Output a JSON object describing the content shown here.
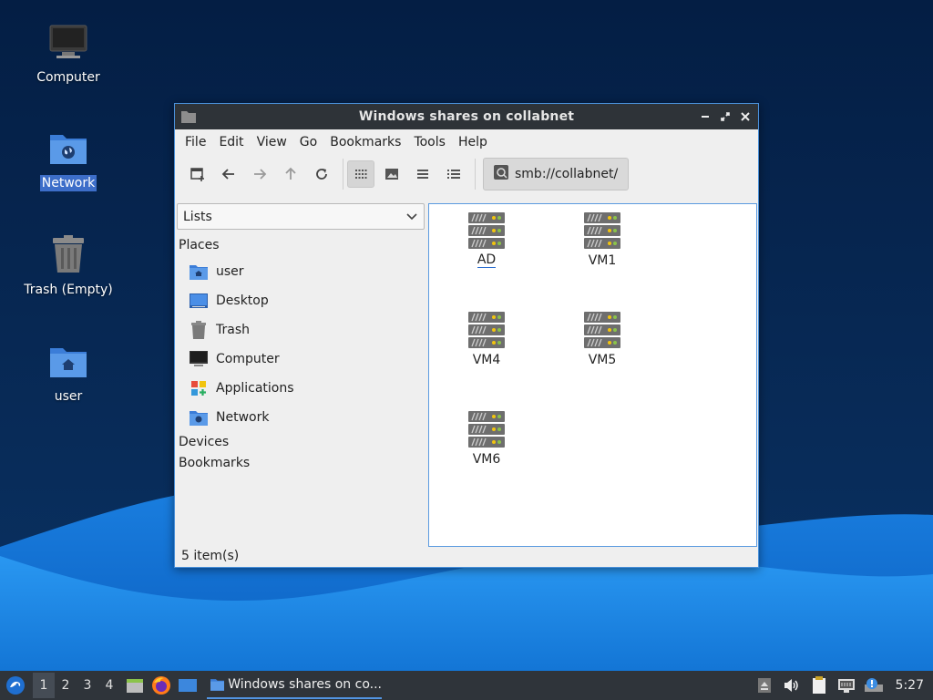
{
  "desktop": {
    "icons": [
      {
        "label": "Computer",
        "icon": "computer-icon",
        "selected": false
      },
      {
        "label": "Network",
        "icon": "network-folder-icon",
        "selected": true
      },
      {
        "label": "Trash (Empty)",
        "icon": "trash-icon",
        "selected": false
      },
      {
        "label": "user",
        "icon": "home-folder-icon",
        "selected": false
      }
    ]
  },
  "window": {
    "title": "Windows shares on collabnet",
    "menu": [
      "File",
      "Edit",
      "View",
      "Go",
      "Bookmarks",
      "Tools",
      "Help"
    ],
    "toolbar": {
      "buttons": [
        "new-tab-icon",
        "back-icon",
        "forward-icon",
        "up-icon",
        "reload-icon",
        "icon-view-icon",
        "thumbnail-view-icon",
        "compact-view-icon",
        "detailed-list-icon"
      ],
      "location": "smb://collabnet/"
    },
    "side_pane": {
      "mode": "Lists",
      "places_header": "Places",
      "places": [
        {
          "label": "user",
          "icon": "home-folder-icon"
        },
        {
          "label": "Desktop",
          "icon": "desktop-icon"
        },
        {
          "label": "Trash",
          "icon": "trash-icon"
        },
        {
          "label": "Computer",
          "icon": "computer-icon"
        },
        {
          "label": "Applications",
          "icon": "applications-icon"
        },
        {
          "label": "Network",
          "icon": "network-folder-icon"
        }
      ],
      "devices_header": "Devices",
      "bookmarks_header": "Bookmarks"
    },
    "files": [
      "AD",
      "VM1",
      "VM4",
      "VM5",
      "VM6"
    ],
    "status": "5 item(s)"
  },
  "taskbar": {
    "workspaces": [
      "1",
      "2",
      "3",
      "4"
    ],
    "current_workspace": "1",
    "task_label": "Windows shares on co...",
    "clock": "5:27"
  },
  "colors": {
    "accent": "#5294e2",
    "titlebar": "#2e3338",
    "taskbar": "#2f343a",
    "desktop_dark": "#06234a",
    "wave_blue": "#1e88e5"
  }
}
